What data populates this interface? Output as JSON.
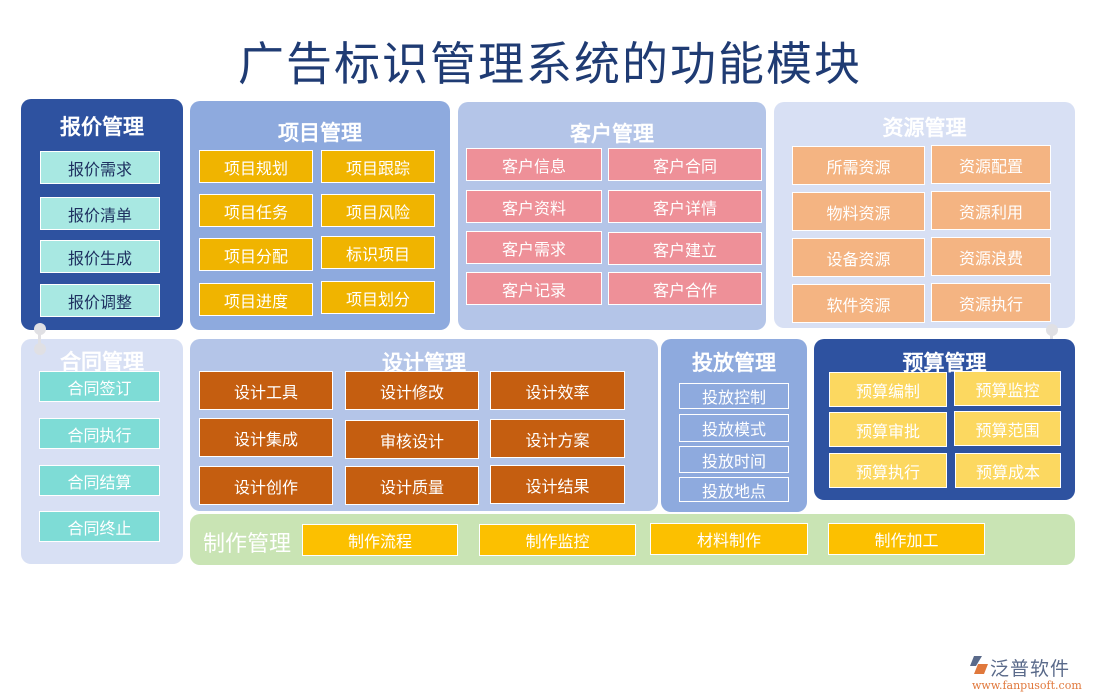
{
  "title": "广告标识管理系统的功能模块",
  "modules": {
    "quote": {
      "title": "报价管理",
      "items": [
        "报价需求",
        "报价清单",
        "报价生成",
        "报价调整"
      ]
    },
    "project": {
      "title": "项目管理",
      "items": [
        "项目规划",
        "项目跟踪",
        "项目任务",
        "项目风险",
        "项目分配",
        "标识项目",
        "项目进度",
        "项目划分"
      ]
    },
    "client": {
      "title": "客户管理",
      "items": [
        "客户信息",
        "客户合同",
        "客户资料",
        "客户详情",
        "客户需求",
        "客户建立",
        "客户记录",
        "客户合作"
      ]
    },
    "resource": {
      "title": "资源管理",
      "items": [
        "所需资源",
        "资源配置",
        "物料资源",
        "资源利用",
        "设备资源",
        "资源浪费",
        "软件资源",
        "资源执行"
      ]
    },
    "contract": {
      "title": "合同管理",
      "items": [
        "合同签订",
        "合同执行",
        "合同结算",
        "合同终止"
      ]
    },
    "design": {
      "title": "设计管理",
      "items": [
        "设计工具",
        "设计修改",
        "设计效率",
        "设计集成",
        "审核设计",
        "设计方案",
        "设计创作",
        "设计质量",
        "设计结果"
      ]
    },
    "delivery": {
      "title": "投放管理",
      "items": [
        "投放控制",
        "投放模式",
        "投放时间",
        "投放地点"
      ]
    },
    "budget": {
      "title": "预算管理",
      "items": [
        "预算编制",
        "预算监控",
        "预算审批",
        "预算范围",
        "预算执行",
        "预算成本"
      ]
    },
    "production": {
      "title": "制作管理",
      "items": [
        "制作流程",
        "制作监控",
        "材料制作",
        "制作加工"
      ]
    }
  },
  "logo": {
    "name": "泛普软件",
    "url": "www.fanpusoft.com",
    "icon": "fanpu-logo-icon"
  }
}
